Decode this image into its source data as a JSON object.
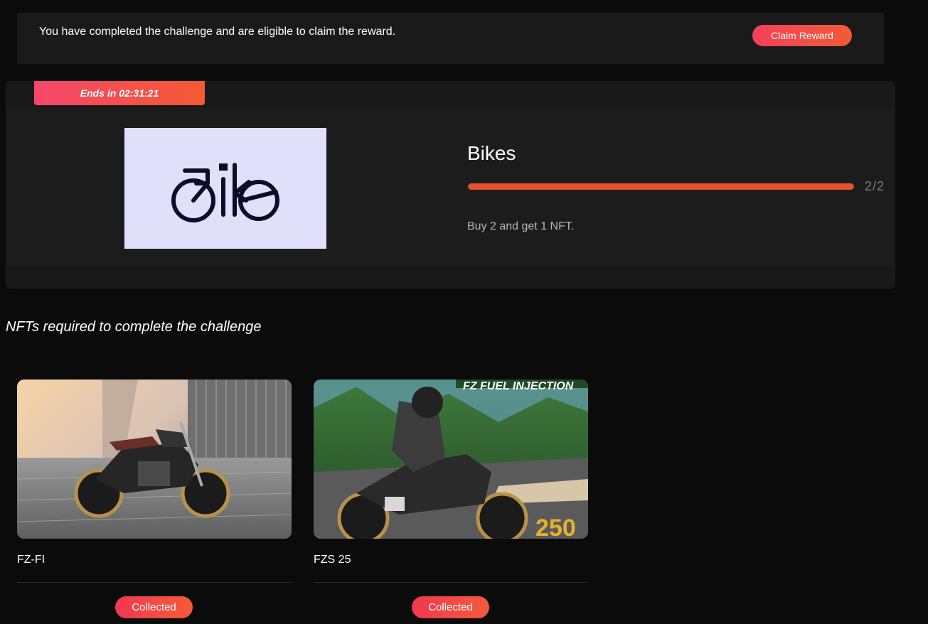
{
  "banner": {
    "message": "You have completed the challenge and are eligible to claim the reward.",
    "claim_label": "Claim Reward"
  },
  "challenge": {
    "ends_in": "Ends in 02:31:21",
    "logo_text": "Bike",
    "title": "Bikes",
    "progress_text": "2/2",
    "progress_fraction": 1.0,
    "description": "Buy 2 and get 1 NFT."
  },
  "nfts_section": {
    "heading": "NFTs required to complete the challenge",
    "items": [
      {
        "name": "FZ-FI",
        "status_label": "Collected",
        "image_alt": "FZ-FI motorcycle in city plaza"
      },
      {
        "name": "FZS 25",
        "status_label": "Collected",
        "image_alt": "FZS 25 rider on mountain road",
        "image_badge": "250"
      }
    ]
  },
  "colors": {
    "accent_start": "#f4405a",
    "accent_end": "#f25b34",
    "progress": "#e5532a",
    "card_bg": "#1a1a1a",
    "page_bg": "#0b0b0b"
  }
}
